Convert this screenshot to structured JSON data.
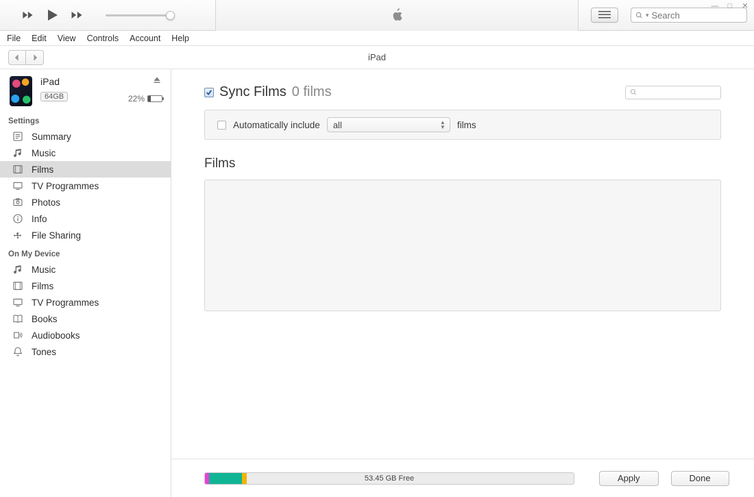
{
  "window_controls": {
    "min": "—",
    "max": "□",
    "close": "✕"
  },
  "menus": [
    "File",
    "Edit",
    "View",
    "Controls",
    "Account",
    "Help"
  ],
  "search_placeholder": "Search",
  "header_title": "iPad",
  "device": {
    "name": "iPad",
    "capacity": "64GB",
    "battery_pct": "22%"
  },
  "sidebar": {
    "settings_label": "Settings",
    "settings": [
      {
        "icon": "summary",
        "label": "Summary"
      },
      {
        "icon": "music",
        "label": "Music"
      },
      {
        "icon": "films",
        "label": "Films"
      },
      {
        "icon": "tv",
        "label": "TV Programmes"
      },
      {
        "icon": "photos",
        "label": "Photos"
      },
      {
        "icon": "info",
        "label": "Info"
      },
      {
        "icon": "apps",
        "label": "File Sharing"
      }
    ],
    "device_label": "On My Device",
    "device_items": [
      {
        "icon": "music",
        "label": "Music"
      },
      {
        "icon": "films",
        "label": "Films"
      },
      {
        "icon": "tv",
        "label": "TV Programmes"
      },
      {
        "icon": "books",
        "label": "Books"
      },
      {
        "icon": "audiobooks",
        "label": "Audiobooks"
      },
      {
        "icon": "tones",
        "label": "Tones"
      }
    ]
  },
  "main": {
    "sync_title": "Sync Films",
    "sync_count": "0 films",
    "auto_label": "Automatically include",
    "auto_dropdown": "all",
    "auto_suffix": "films",
    "films_heading": "Films"
  },
  "footer": {
    "free_label": "53.45 GB Free",
    "apply": "Apply",
    "done": "Done"
  }
}
